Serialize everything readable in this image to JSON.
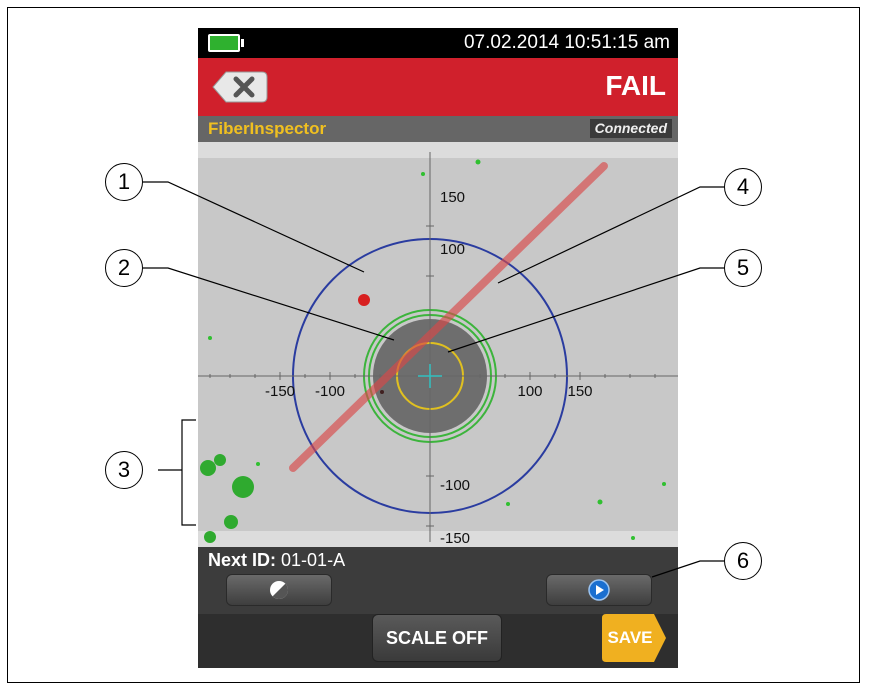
{
  "status_bar": {
    "datetime": "07.02.2014 10:51:15 am",
    "battery_icon": "battery-icon"
  },
  "title_bar": {
    "result": "FAIL",
    "back_icon": "back-x-icon"
  },
  "app_bar": {
    "app_name": "FiberInspector",
    "connection_status": "Connected"
  },
  "scale": {
    "axis_ticks_x_left": [
      "-150",
      "-100"
    ],
    "axis_ticks_x_right": [
      "100",
      "150"
    ],
    "axis_ticks_y_top": [
      "150",
      "100"
    ],
    "axis_ticks_y_bottom": [
      "-100",
      "-150"
    ]
  },
  "next_id": {
    "label": "Next ID:",
    "value": "01-01-A"
  },
  "soft_keys": {
    "left_icon": "contrast-icon",
    "right_icon": "play-icon"
  },
  "bottom_bar": {
    "scale_button": "SCALE OFF",
    "save_button": "SAVE"
  },
  "callouts": [
    "1",
    "2",
    "3",
    "4",
    "5",
    "6"
  ],
  "colors": {
    "fail_red": "#d0202c",
    "app_name_yellow": "#f0c020",
    "save_orange": "#f0b020"
  }
}
